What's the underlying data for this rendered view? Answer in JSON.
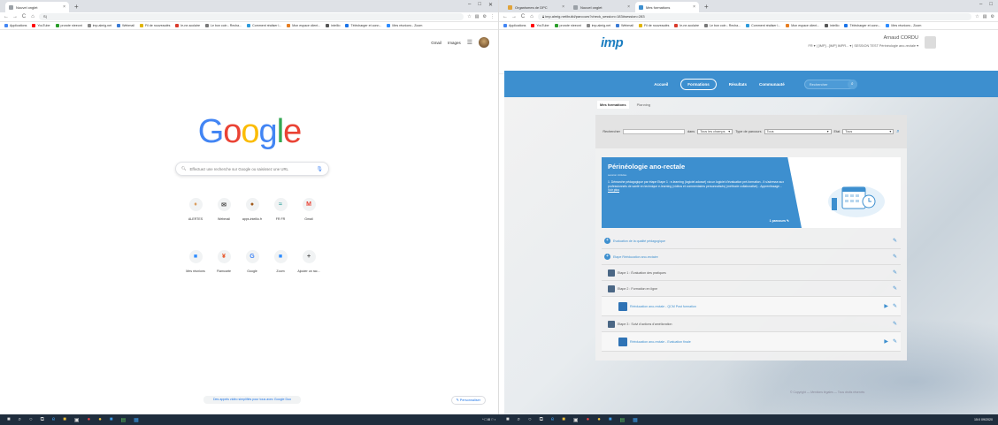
{
  "left_window": {
    "tab_title": "Nouvel onglet",
    "omnibox_text": "S|",
    "window_controls": [
      "–",
      "□",
      "✕"
    ],
    "toolbar_icons": [
      "☆",
      "▤",
      "⚙",
      "⋮"
    ]
  },
  "right_window": {
    "tabs": [
      {
        "title": "Organismes de DPC"
      },
      {
        "title": "Nouvel onglet"
      },
      {
        "title": "Mes formations"
      }
    ],
    "omnibox_text": "imp.almig.net/build/parcours?check_session=183#session=283",
    "window_controls": [
      "–",
      "□"
    ],
    "toolbar_icons": [
      "☆",
      "▤",
      "⚙"
    ]
  },
  "bookmarks": [
    {
      "label": "Applications",
      "color": "#4285f4"
    },
    {
      "label": "YouTube",
      "color": "#ff0000"
    },
    {
      "label": "prorote nieeont",
      "color": "#2a9d2a"
    },
    {
      "label": "imp.almig.net",
      "color": "#888"
    },
    {
      "label": "Webmail",
      "color": "#3a7bd5"
    },
    {
      "label": "Fil de nouveautés",
      "color": "#e0b400"
    },
    {
      "label": "le-ne-scolaire",
      "color": "#d93a2b"
    },
    {
      "label": "Le bon coin - Recha...",
      "color": "#777"
    },
    {
      "label": "Comment réaliser l...",
      "color": "#2e9bdb"
    },
    {
      "label": "Mon espace client...",
      "color": "#e67e22"
    },
    {
      "label": "intellio",
      "color": "#555"
    },
    {
      "label": "Télécharger et conn...",
      "color": "#1a73e8"
    },
    {
      "label": "Mes réunions - Zoom",
      "color": "#2d8cff"
    }
  ],
  "google": {
    "top_links": [
      "Gmail",
      "Images"
    ],
    "logo_letters": [
      "G",
      "o",
      "o",
      "g",
      "l",
      "e"
    ],
    "search_placeholder": "Effectuez une recherche sur Google ou saisissez une URL",
    "shortcuts_row1": [
      {
        "label": "ALERTES",
        "glyph": "♦",
        "color": "#d99b5a"
      },
      {
        "label": "Webmail",
        "glyph": "✉",
        "color": "#555"
      },
      {
        "label": "apps.intellio.fr",
        "glyph": "●",
        "color": "#a0591a"
      },
      {
        "label": "FR FR",
        "glyph": "≈",
        "color": "#3ca7a2"
      },
      {
        "label": "Gmail",
        "glyph": "M",
        "color": "#ea4335"
      }
    ],
    "shortcuts_row2": [
      {
        "label": "Mes réunions",
        "glyph": "■",
        "color": "#2d8cff"
      },
      {
        "label": "Flamcarte",
        "glyph": "¥",
        "color": "#e64a19"
      },
      {
        "label": "Google",
        "glyph": "G",
        "color": "#4285f4"
      },
      {
        "label": "Zoom",
        "glyph": "■",
        "color": "#2d8cff"
      },
      {
        "label": "Ajouter un rac...",
        "glyph": "+",
        "color": "#555"
      }
    ],
    "footer_notice": "Des appels vidéo simplifiés pour tous avec Google Duo",
    "customize_label": "Personnaliser"
  },
  "imp": {
    "logo_text": "imp",
    "user_name": "Arnaud CORDU",
    "breadcrumb": "FR ▾   |  [IMP]...[IMP] IMPR... ▾  |  SESSION TEST Périnéologie ano-rectale ▾",
    "nav_items": [
      "Accueil",
      "Formations",
      "Résultats",
      "Communauté"
    ],
    "search_placeholder": "Rechercher",
    "subtabs": [
      "Mes formations",
      "Planning"
    ],
    "filter": {
      "search_label": "Rechercher",
      "in_label": "dans",
      "in_value": "Tous les champs",
      "type_label": "Type de parcours",
      "type_value": "Tous",
      "state_label": "Etat",
      "state_value": "Tous"
    },
    "course": {
      "title": "Périnéologie ano-rectale",
      "subtitle": "session intitulée",
      "description": "1. Démarche pédagogique par étape Etape 1 : e-learning (logiciel adossé) via un logiciel d'évaluation pré-formation - Il s'adresse aux professionnels de santé en technique e-learning (vidéos et commentaires personnalisés) (méthode collaborative) - Apprentissage...",
      "more_label": "Voir plus",
      "parcours_label": "1 parcours"
    },
    "steps": [
      {
        "label": "Evaluation de la qualité pédagogique",
        "level": 1
      },
      {
        "label": "Etape Rééducation ano-rectaire",
        "level": 1
      },
      {
        "label": "Etape 1 : Évaluation des pratiques",
        "level": 2
      },
      {
        "label": "Etape 2 : Formation en ligne",
        "level": 2
      },
      {
        "label": "Rééducation ano-rectale - QCM Post formation",
        "level": 3
      },
      {
        "label": "Etape 3 : Suivi d'actions d'amélioration",
        "level": 2
      },
      {
        "label": "Rééducation ano-rectale - Evaluation finale",
        "level": 3
      }
    ],
    "footer_text": "© Copyright — Mentions légales — Tous droits réservés"
  },
  "taskbar": {
    "left_time": "",
    "right_time": "15:0\n09/2020"
  }
}
